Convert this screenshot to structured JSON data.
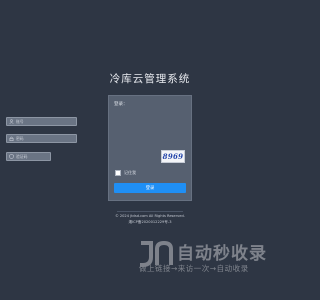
{
  "page": {
    "title": "冷库云管理系统"
  },
  "login": {
    "label": "登录：",
    "username_placeholder": "账号",
    "password_placeholder": "密码",
    "captcha_placeholder": "验证码",
    "captcha_text": "8969",
    "remember_label": "记住我",
    "submit_label": "登录"
  },
  "footer": {
    "copyright": "© 2024 jtdsd.com All Rights Reserved.",
    "icp": "湘ICP备2020012229号-3"
  },
  "watermark": {
    "main_text": "自动秒收录",
    "sub_text": "做上链接→来访一次→自动收录"
  },
  "colors": {
    "background": "#2e3644",
    "panel": "#566070",
    "primary_button": "#1f8ff5"
  }
}
